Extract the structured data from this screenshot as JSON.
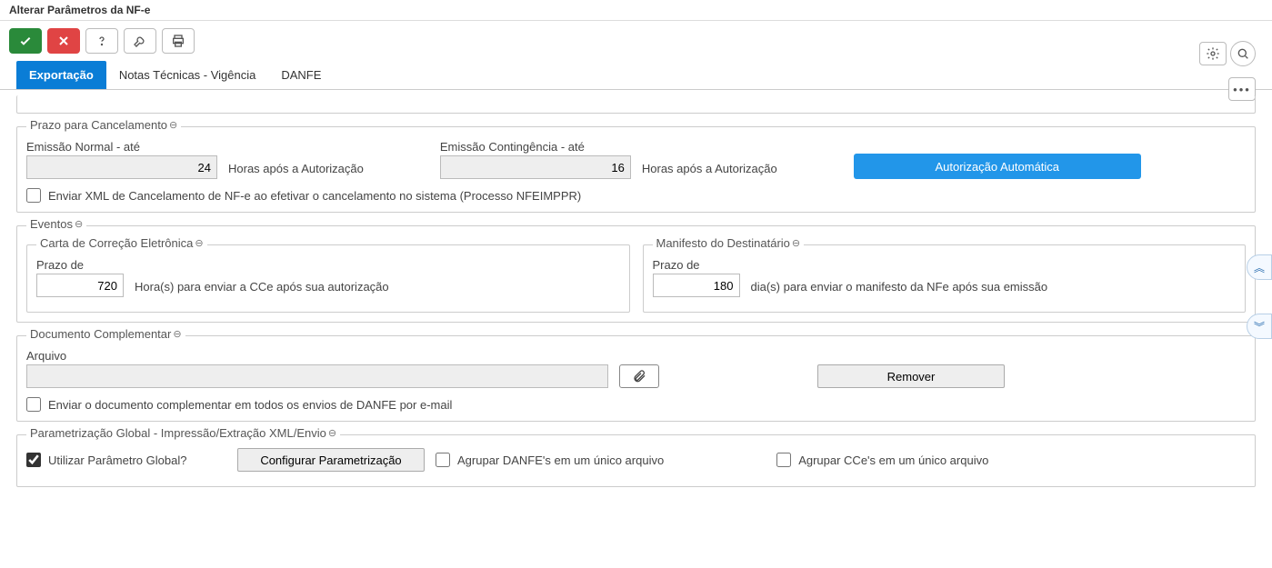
{
  "window_title": "Alterar Parâmetros da NF-e",
  "tabs": {
    "exportacao": "Exportação",
    "notas": "Notas Técnicas - Vigência",
    "danfe": "DANFE"
  },
  "prazo_cancel": {
    "legend": "Prazo para Cancelamento",
    "normal_label": "Emissão Normal - até",
    "normal_value": "24",
    "conting_label": "Emissão Contingência - até",
    "conting_value": "16",
    "hint": "Horas após a Autorização",
    "btn": "Autorização Automática",
    "chk_cancel_xml": "Enviar XML de Cancelamento de NF-e ao efetivar o cancelamento no sistema (Processo NFEIMPPR)"
  },
  "eventos": {
    "legend": "Eventos",
    "cce": {
      "legend": "Carta de Correção Eletrônica",
      "prazo_label": "Prazo de",
      "prazo_value": "720",
      "hint": "Hora(s) para enviar a CCe após sua autorização"
    },
    "manifesto": {
      "legend": "Manifesto do Destinatário",
      "prazo_label": "Prazo de",
      "prazo_value": "180",
      "hint": "dia(s) para enviar o manifesto da NFe após sua emissão"
    }
  },
  "doc_comp": {
    "legend": "Documento Complementar",
    "arquivo_label": "Arquivo",
    "remover": "Remover",
    "chk": "Enviar o documento complementar em todos os envios de DANFE por e-mail"
  },
  "param_global": {
    "legend": "Parametrização Global - Impressão/Extração XML/Envio",
    "chk_usar": "Utilizar Parâmetro Global?",
    "btn_config": "Configurar Parametrização",
    "chk_danfe": "Agrupar DANFE's em um único arquivo",
    "chk_cce": "Agrupar CCe's em um único arquivo"
  }
}
